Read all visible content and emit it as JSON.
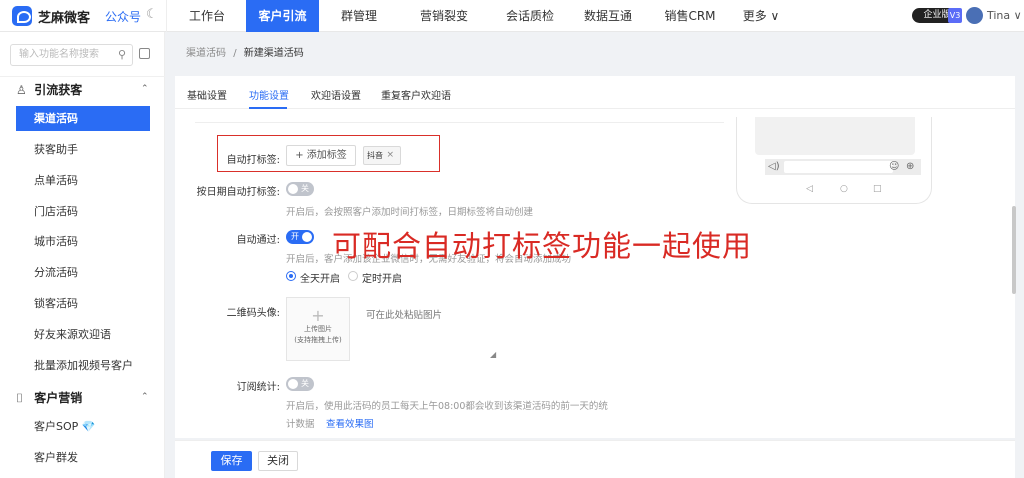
{
  "topbar": {
    "brand": "芝麻微客",
    "account": "公众号",
    "nav": [
      "工作台",
      "客户引流",
      "群管理",
      "营销裂变",
      "会话质检",
      "数据互通",
      "销售CRM",
      "更多 ∨"
    ],
    "active_nav": "客户引流",
    "edition_badge": "企业版",
    "version_badge": "V3",
    "user_name": "Tina ∨"
  },
  "sidebar": {
    "search_placeholder": "输入功能名称搜索",
    "groups": [
      {
        "title": "引流获客",
        "items": [
          "渠道活码",
          "获客助手",
          "点单活码",
          "门店活码",
          "城市活码",
          "分流活码",
          "锁客活码",
          "好友来源欢迎语",
          "批量添加视频号客户"
        ]
      },
      {
        "title": "客户营销",
        "items": [
          "客户SOP 💎",
          "客户群发"
        ]
      }
    ],
    "active_item": "渠道活码"
  },
  "breadcrumb": {
    "parent": "渠道活码",
    "separator": "/",
    "current": "新建渠道活码"
  },
  "tabs": [
    "基础设置",
    "功能设置",
    "欢迎语设置",
    "重复客户欢迎语"
  ],
  "active_tab": "功能设置",
  "form": {
    "auto_tag_label": "自动打标签:",
    "add_tag_button": "+ 添加标签",
    "tag_value": "抖音",
    "tag_remove": "×",
    "date_tag_label": "按日期自动打标签:",
    "date_tag_switch": "关",
    "date_tag_hint": "开启后，会按照客户添加时间打标签，日期标签将自动创建",
    "auto_pass_label": "自动通过:",
    "auto_pass_switch": "开",
    "auto_pass_hint": "开启后，客户添加该企业微信时，无需好友验证，将会自动添加成功",
    "radio_all_day": "全天开启",
    "radio_scheduled": "定时开启",
    "qr_avatar_label": "二维码头像:",
    "upload_icon": "+",
    "upload_text1": "上传图片",
    "upload_text2": "(支持拖拽上传)",
    "paste_hint": "可在此处粘贴图片",
    "resize_glyph": "◢",
    "subscribe_label": "订阅统计:",
    "subscribe_switch": "关",
    "subscribe_hint1": "开启后，使用此活码的员工每天上午08:00都会收到该渠道活码的前一天的统",
    "subscribe_hint2": "计数据",
    "view_effect_link": "查看效果图"
  },
  "overlay_text": "可配合自动打标签功能一起使用",
  "phone_preview": {
    "voice_icon": "◁)",
    "emoji_icon": "☺",
    "plus_icon": "⊕",
    "nav_back": "◁",
    "nav_home": "○",
    "nav_recent": "□"
  },
  "footer": {
    "save": "保存",
    "close": "关闭"
  },
  "colors": {
    "primary": "#2a6cf4",
    "highlight_red": "#d9302a"
  }
}
